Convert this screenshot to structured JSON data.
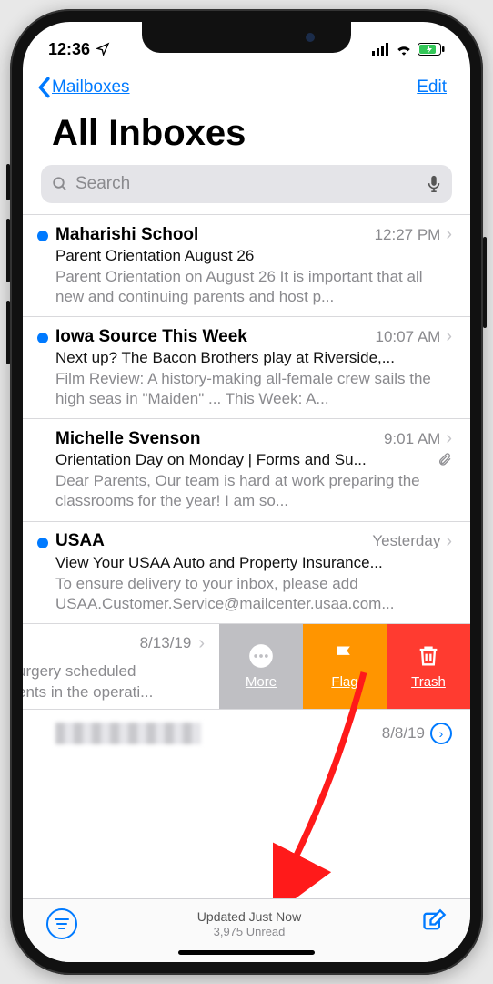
{
  "statusBar": {
    "time": "12:36"
  },
  "nav": {
    "back": "Mailboxes",
    "edit": "Edit"
  },
  "title": "All Inboxes",
  "search": {
    "placeholder": "Search"
  },
  "emails": [
    {
      "unread": true,
      "sender": "Maharishi School",
      "time": "12:27 PM",
      "subject": "Parent Orientation August 26",
      "preview": "Parent Orientation on August 26 It is important that all new and continuing parents and host p...",
      "attachment": false
    },
    {
      "unread": true,
      "sender": "Iowa Source This Week",
      "time": "10:07 AM",
      "subject": "Next up? The Bacon Brothers play at Riverside,...",
      "preview": "Film Review: A history-making all-female crew sails the high seas in \"Maiden\" ... This Week: A...",
      "attachment": false
    },
    {
      "unread": false,
      "sender": "Michelle Svenson",
      "time": "9:01 AM",
      "subject": "Orientation Day on Monday | Forms and Su...",
      "preview": "Dear Parents, Our team is hard at work preparing the classrooms for the year! I am so...",
      "attachment": true
    },
    {
      "unread": true,
      "sender": "USAA",
      "time": "Yesterday",
      "subject": "View Your USAA Auto and Property Insurance...",
      "preview": "To ensure delivery to your inbox, please add USAA.Customer.Service@mailcenter.usaa.com...",
      "attachment": false
    }
  ],
  "swipe": {
    "date": "8/13/19",
    "line1": "urgery scheduled",
    "line2": "ents in the operati...",
    "more": "More",
    "flag": "Flag",
    "trash": "Trash"
  },
  "blurRow": {
    "date": "8/8/19"
  },
  "toolbar": {
    "status": "Updated Just Now",
    "unread": "3,975 Unread"
  }
}
